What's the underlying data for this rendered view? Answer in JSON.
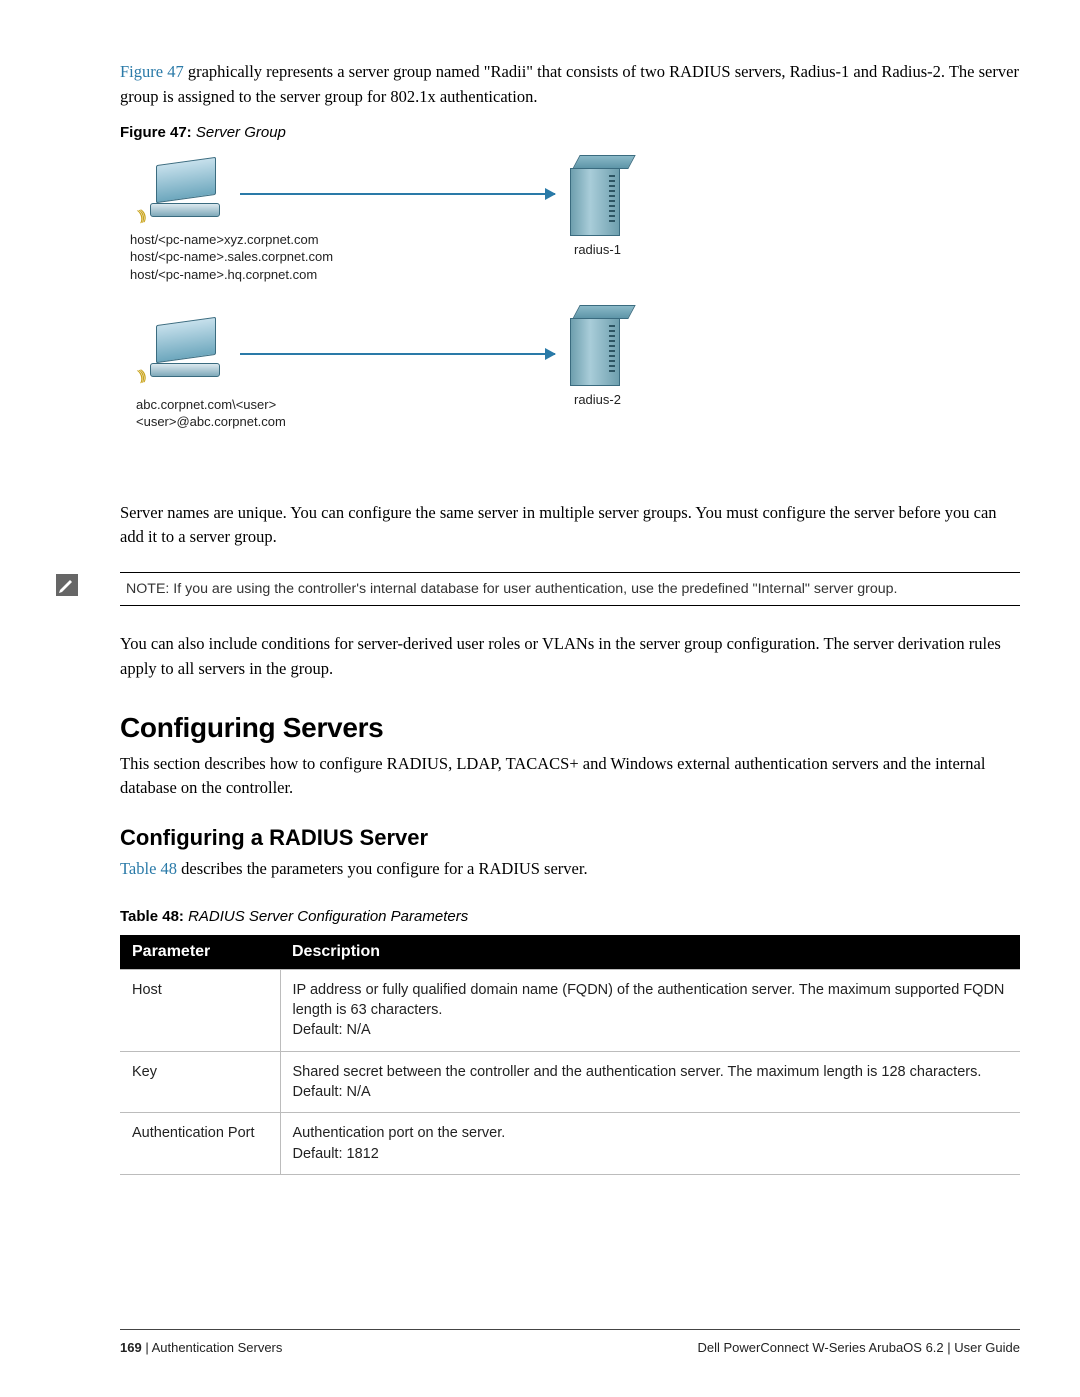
{
  "intro": {
    "figure_ref": "Figure 47",
    "text_after_ref": " graphically represents a server group named \"Radii\" that consists of two RADIUS servers, Radius-1 and Radius-2. The server group is assigned to the server group for 802.1x authentication."
  },
  "figure_caption": {
    "label": "Figure 47:",
    "title": " Server Group"
  },
  "figure_labels": {
    "host1": "host/<pc-name>xyz.corpnet.com\nhost/<pc-name>.sales.corpnet.com\nhost/<pc-name>.hq.corpnet.com",
    "host2": "abc.corpnet.com\\<user>\n<user>@abc.corpnet.com",
    "server1": "radius-1",
    "server2": "radius-2"
  },
  "para_server_names": "Server names are unique. You can configure the same server in multiple server groups. You must configure the server before you can add it to a server group.",
  "note_text": "NOTE: If you are using the controller's internal database for user authentication, use the predefined \"Internal\" server group.",
  "para_conditions": "You can also include conditions for server-derived user roles or VLANs in the server group configuration. The server derivation rules apply to all servers in the group.",
  "h1_configuring_servers": "Configuring Servers",
  "para_configuring_servers": "This section describes how to configure RADIUS, LDAP, TACACS+ and Windows external authentication servers and the internal database on the controller.",
  "h2_configuring_radius": "Configuring a RADIUS Server",
  "radius_intro_ref": "Table 48",
  "radius_intro_rest": " describes the parameters you configure for a RADIUS server.",
  "table_caption": {
    "label": "Table 48:",
    "title": " RADIUS Server Configuration Parameters"
  },
  "table": {
    "headers": [
      "Parameter",
      "Description"
    ],
    "rows": [
      {
        "param": "Host",
        "desc": "IP address or fully qualified domain name (FQDN) of the authentication server. The maximum supported FQDN length is 63 characters.\nDefault: N/A"
      },
      {
        "param": "Key",
        "desc": "Shared secret between the controller and the authentication server. The maximum length is 128 characters.\nDefault: N/A"
      },
      {
        "param": "Authentication Port",
        "desc": "Authentication port on the server.\nDefault: 1812"
      }
    ]
  },
  "footer": {
    "page_num": "169",
    "left_rest": " | Authentication Servers",
    "right": "Dell PowerConnect W-Series ArubaOS 6.2  |  User Guide"
  }
}
